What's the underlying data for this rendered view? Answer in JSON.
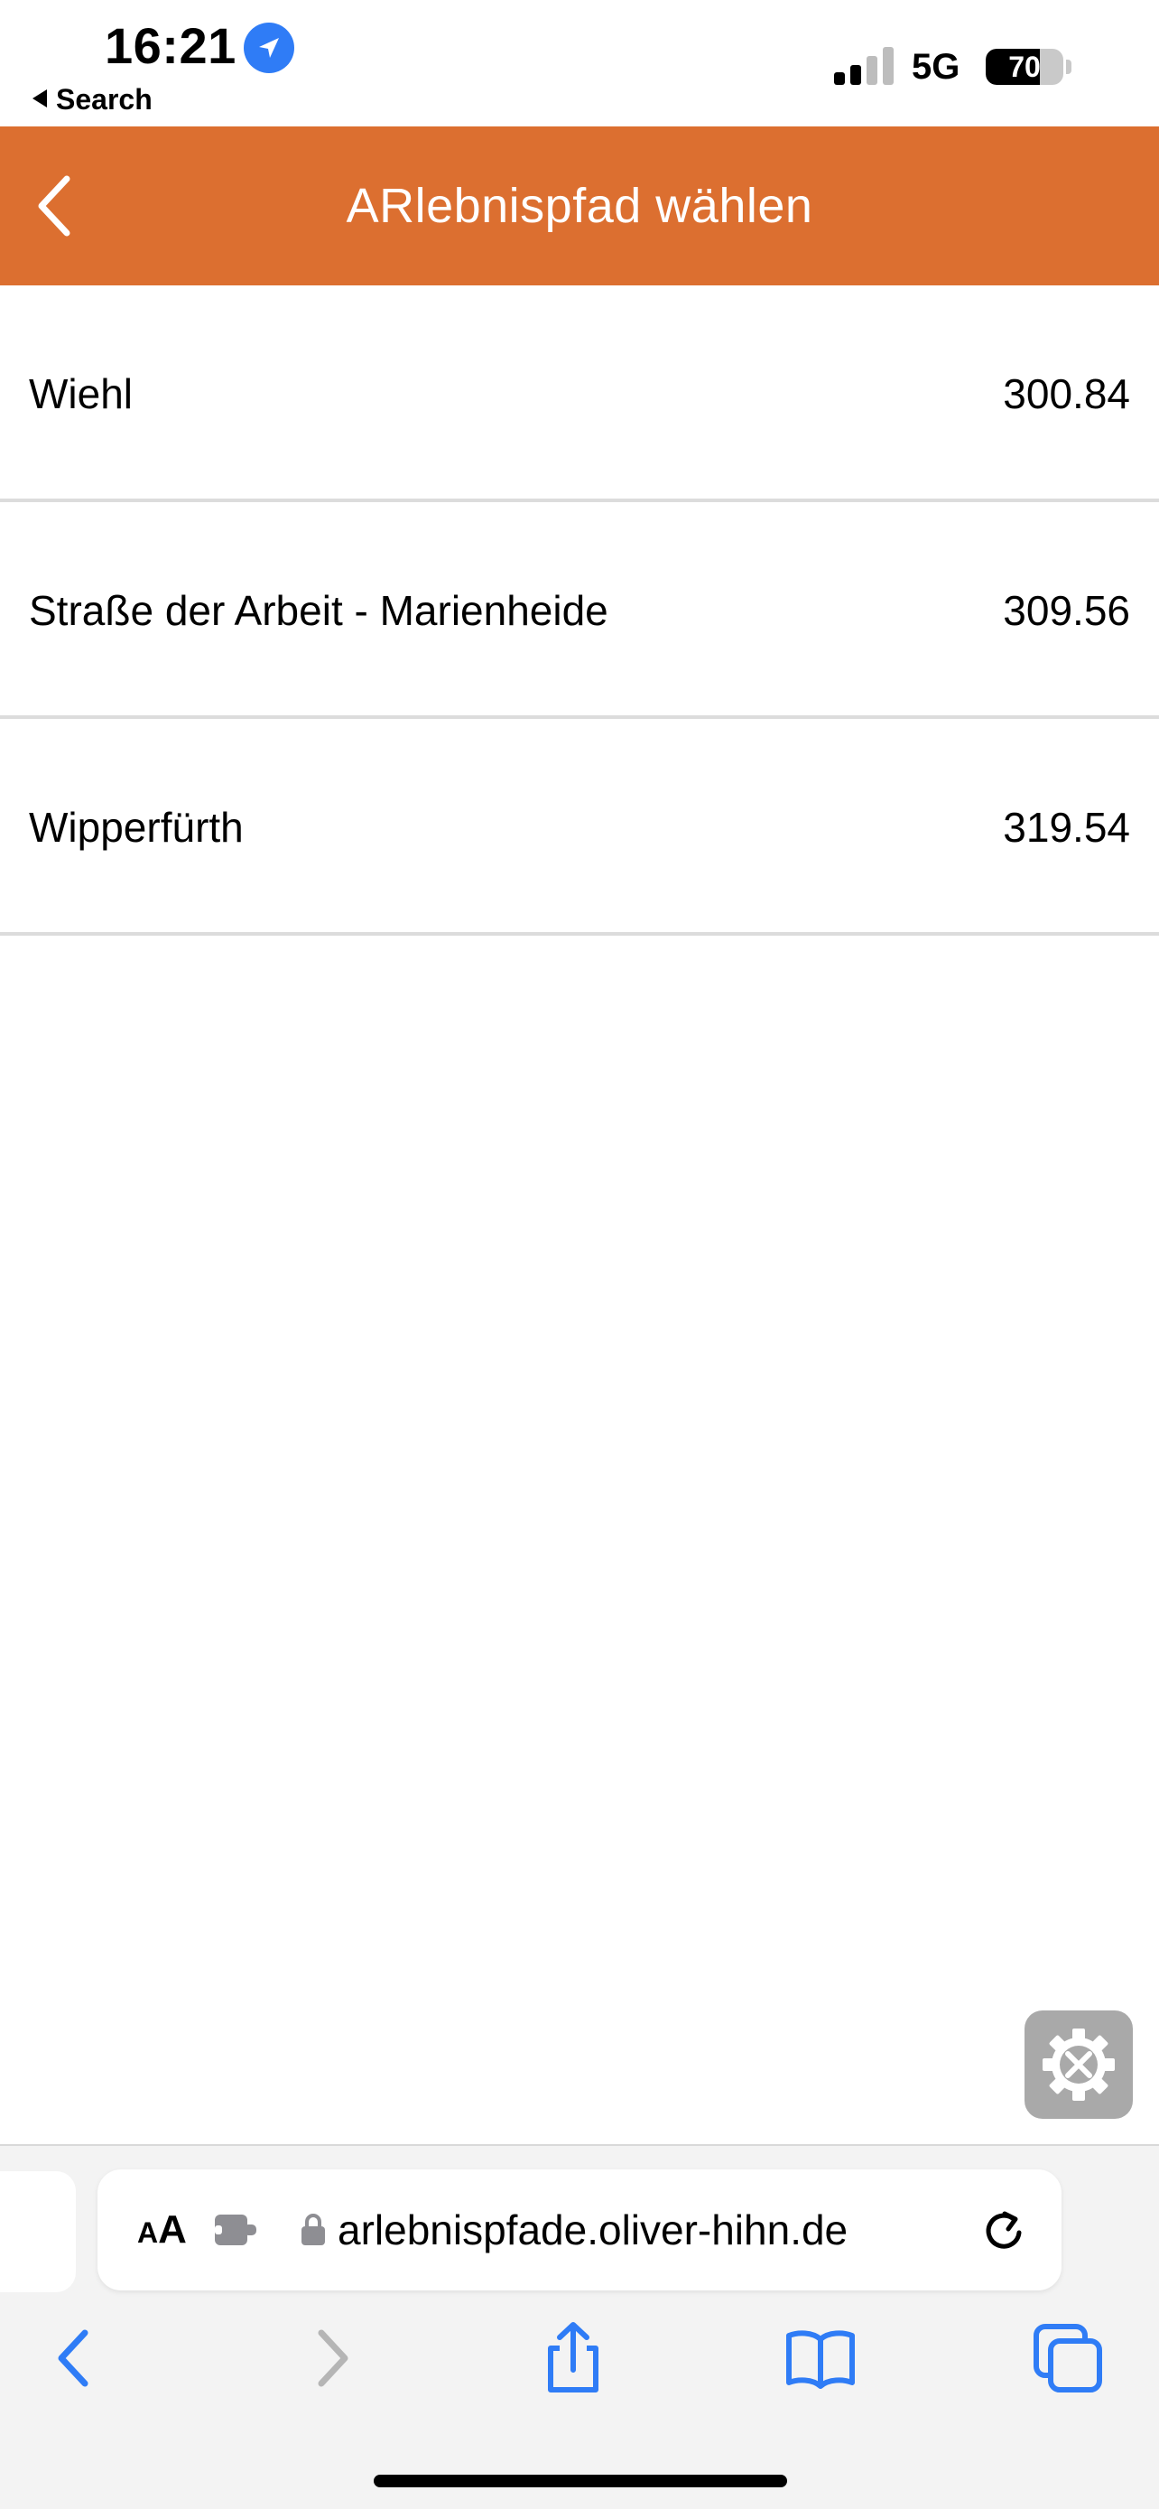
{
  "status_bar": {
    "time": "16:21",
    "back_app": "Search",
    "network": "5G",
    "battery": "70",
    "battery_level": 0.7
  },
  "header": {
    "title": "ARlebnispfad wählen",
    "accent_color": "#dc6f30"
  },
  "list": {
    "items": [
      {
        "name": "Wiehl",
        "value": "300.84"
      },
      {
        "name": "Straße der Arbeit - Marienheide",
        "value": "309.56"
      },
      {
        "name": "Wipperfürth",
        "value": "319.54"
      }
    ]
  },
  "browser": {
    "text_size_label_small": "A",
    "text_size_label_large": "A",
    "url": "arlebnispfade.oliver-hihn.de",
    "accent_color": "#2f7cf6"
  },
  "icons": {
    "location": "location-arrow-icon",
    "settings": "settings-tools-icon",
    "back": "chevron-left-icon",
    "forward": "chevron-right-icon",
    "share": "share-icon",
    "bookmarks": "book-icon",
    "tabs": "tabs-icon"
  }
}
